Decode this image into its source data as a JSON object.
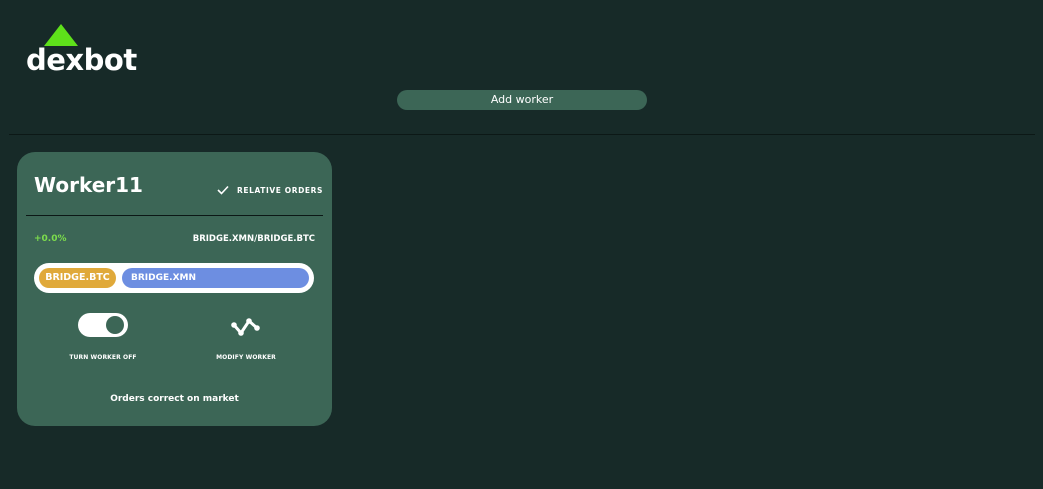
{
  "app": {
    "logo_text": "dexbot",
    "add_worker_label": "Add worker"
  },
  "colors": {
    "background": "#172a28",
    "card": "#3c6656",
    "accent_green": "#5ee01a",
    "profit_green": "#7cdd4c",
    "base_asset": "#e0a93a",
    "quote_asset": "#6d8ee1"
  },
  "workers": [
    {
      "name": "Worker11",
      "relative_orders_label": "RELATIVE ORDERS",
      "relative_orders_checked": true,
      "profit": "+0.0%",
      "market": "BRIDGE.XMN/BRIDGE.BTC",
      "base_asset": "BRIDGE.BTC",
      "quote_asset": "BRIDGE.XMN",
      "toggle_on": true,
      "toggle_label": "TURN WORKER OFF",
      "modify_label": "MODIFY WORKER",
      "modify_icon": "modify-icon",
      "status": "Orders correct on market"
    }
  ]
}
